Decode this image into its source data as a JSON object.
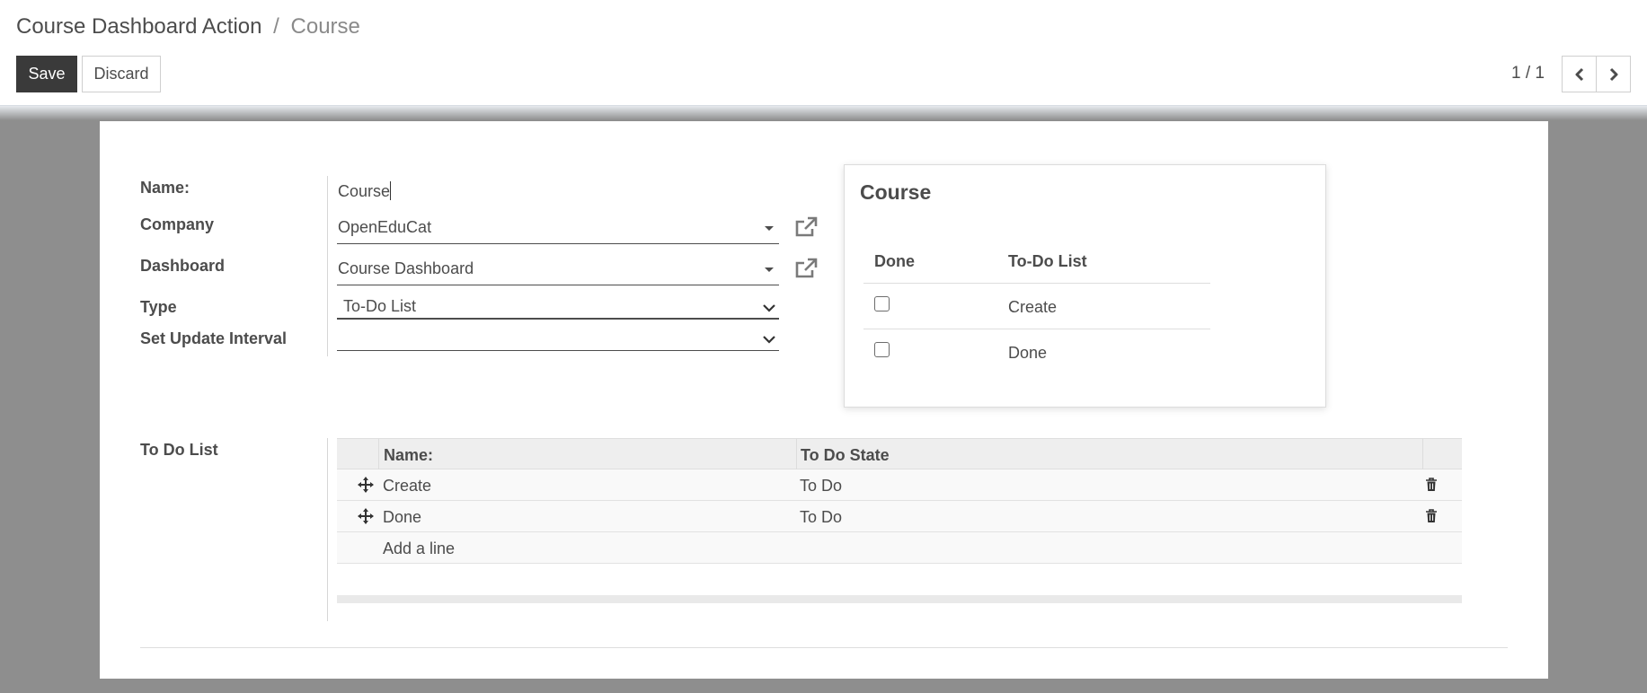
{
  "breadcrumb": {
    "parent": "Course Dashboard Action",
    "separator": "/",
    "current": "Course"
  },
  "buttons": {
    "save": "Save",
    "discard": "Discard"
  },
  "pager": {
    "value": "1 / 1"
  },
  "form": {
    "name": {
      "label": "Name:",
      "value": "Course"
    },
    "company": {
      "label": "Company",
      "value": "OpenEduCat"
    },
    "dashboard": {
      "label": "Dashboard",
      "value": "Course Dashboard"
    },
    "type": {
      "label": "Type",
      "value": "To-Do List"
    },
    "update_interval": {
      "label": "Set Update Interval",
      "value": ""
    },
    "todo_list": {
      "label": "To Do List"
    }
  },
  "preview": {
    "title": "Course",
    "columns": [
      "Done",
      "To-Do List"
    ],
    "rows": [
      {
        "done": false,
        "item": "Create"
      },
      {
        "done": false,
        "item": "Done"
      }
    ]
  },
  "todo_table": {
    "columns": [
      "Name:",
      "To Do State"
    ],
    "rows": [
      {
        "name": "Create",
        "state": "To Do"
      },
      {
        "name": "Done",
        "state": "To Do"
      }
    ],
    "add_line": "Add a line"
  },
  "icons": {
    "external_link": "external-link-icon",
    "caret": "caret-down-icon",
    "chevron": "chevron-down-icon",
    "drag": "move-icon",
    "trash": "trash-icon",
    "prev": "chevron-left-icon",
    "next": "chevron-right-icon"
  },
  "colors": {
    "primary_button": "#3a3a3a",
    "backdrop": "#8e8e8e",
    "text": "#4c4c4c"
  }
}
